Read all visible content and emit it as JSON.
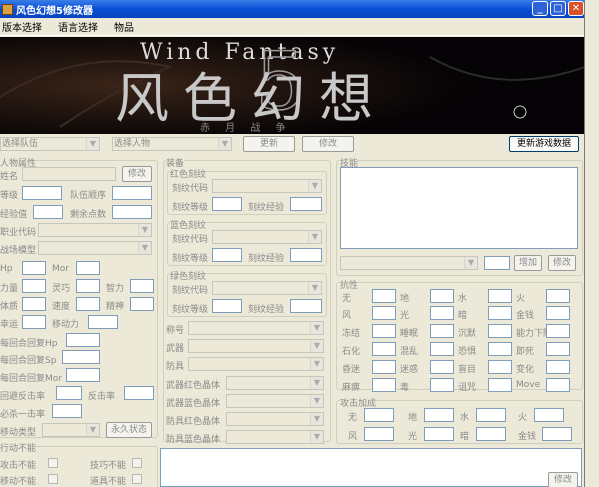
{
  "window": {
    "title": "风色幻想5修改器",
    "close_glyph": "✕",
    "min_glyph": "_",
    "max_glyph": "□"
  },
  "menu": [
    "版本选择",
    "语言选择",
    "物品"
  ],
  "banner": {
    "text_en": "Wind Fantasy",
    "text_cn": "风色幻想",
    "numeral": "5",
    "sub": "赤 月 战 争"
  },
  "top": {
    "team_select": "选择队伍",
    "char_select": "选择人物",
    "update": "更新",
    "modify": "修改",
    "refresh": "更新游戏数据"
  },
  "char": {
    "group": "人物属性",
    "name": "姓名",
    "modify": "修改",
    "level": "等级",
    "order": "队伍顺序",
    "exp": "经验值",
    "points": "剩余点数",
    "class_code": "职业代码",
    "battle_model": "战场模型",
    "hp": "Hp",
    "mor": "Mor",
    "str": "力量",
    "agi": "灵巧",
    "int": "智力",
    "vit": "体质",
    "spd": "速度",
    "spi": "精神",
    "luk": "幸运",
    "move": "移动力",
    "regen_hp": "每回合回复Hp",
    "regen_sp": "每回合回复Sp",
    "regen_mor": "每回合回复Mor",
    "evade": "回避反击率",
    "counter": "反击率",
    "crit": "必杀一击率",
    "move_type": "移动类型",
    "perm": "永久状态",
    "disable_group": "行动不能",
    "atk_disable": "攻击不能",
    "skill_disable": "技巧不能",
    "move_disable": "移动不能",
    "item_disable": "道具不能"
  },
  "equip": {
    "group": "装备",
    "red": "红色刻纹",
    "blue": "蓝色刻纹",
    "green": "绿色刻纹",
    "code": "刻纹代码",
    "lv": "刻纹等级",
    "xp": "刻纹经验",
    "title": "称号",
    "weapon": "武器",
    "armor": "防具",
    "w_red": "武器红色晶体",
    "w_blue": "武器蓝色晶体",
    "a_red": "防具红色晶体",
    "a_blue": "防具蓝色晶体"
  },
  "skills": {
    "group": "技能",
    "add": "增加",
    "modify": "修改"
  },
  "resist": {
    "group": "抗性",
    "items": [
      "无",
      "地",
      "水",
      "火",
      "风",
      "光",
      "暗",
      "金钱",
      "冻结",
      "睡眠",
      "沉默",
      "能力下降",
      "石化",
      "混乱",
      "恐惧",
      "即死",
      "昏迷",
      "迷惑",
      "盲目",
      "变化",
      "麻痹",
      "毒",
      "诅咒",
      "Move"
    ]
  },
  "attack": {
    "group": "攻击加成",
    "items": [
      "无",
      "地",
      "水",
      "火",
      "风",
      "光",
      "暗",
      "金钱"
    ]
  },
  "bottom": {
    "modify": "修改"
  }
}
